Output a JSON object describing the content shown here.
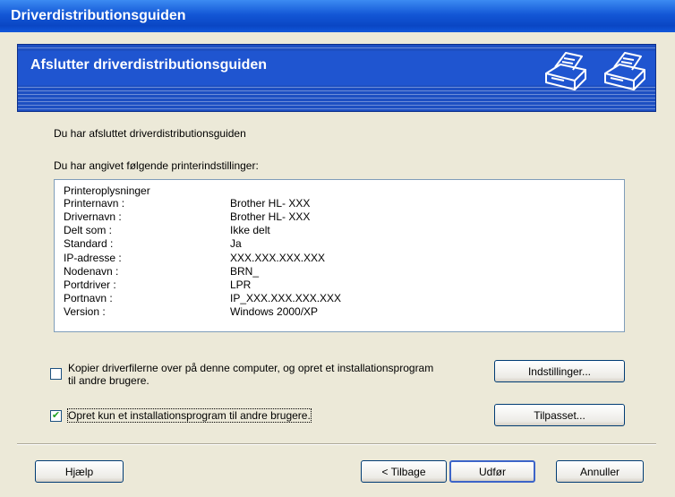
{
  "window": {
    "title": "Driverdistributionsguiden"
  },
  "banner": {
    "title": "Afslutter driverdistributionsguiden",
    "icons": [
      "printer-icon",
      "printer-icon"
    ]
  },
  "main": {
    "finished_text": "Du har afsluttet driverdistributionsguiden",
    "settings_heading": "Du har angivet følgende printerindstillinger:",
    "info_header": "Printeroplysninger",
    "rows": [
      {
        "key": "Printernavn :",
        "value": "Brother HL- XXX"
      },
      {
        "key": "Drivernavn :",
        "value": "Brother HL- XXX"
      },
      {
        "key": "Delt som :",
        "value": "Ikke delt"
      },
      {
        "key": "Standard :",
        "value": "Ja"
      },
      {
        "key": "IP-adresse :",
        "value": "XXX.XXX.XXX.XXX"
      },
      {
        "key": "Nodenavn :",
        "value": "BRN_"
      },
      {
        "key": "Portdriver :",
        "value": "LPR"
      },
      {
        "key": "Portnavn :",
        "value": "IP_XXX.XXX.XXX.XXX"
      },
      {
        "key": "Version :",
        "value": "Windows 2000/XP"
      }
    ]
  },
  "options": {
    "copy_option": {
      "line1": "Kopier driverfilerne over på denne computer, og opret et installationsprogram",
      "line2": "til andre brugere.",
      "checked": false
    },
    "create_option": {
      "label": "Opret kun et installationsprogram til andre brugere.",
      "checked": true
    },
    "settings_button": "Indstillinger...",
    "custom_button": "Tilpasset..."
  },
  "footer": {
    "help_button": "Hjælp",
    "back_button": "< Tilbage",
    "finish_button": "Udfør",
    "cancel_button": "Annuller"
  }
}
